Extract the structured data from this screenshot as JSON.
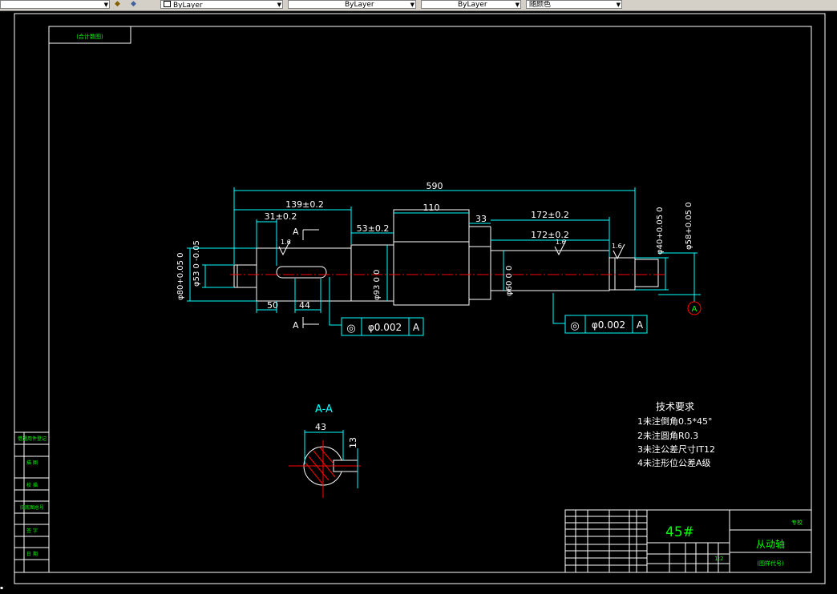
{
  "toolbar": {
    "layer1": "ByLayer",
    "layer2": "ByLayer",
    "layer3": "ByLayer",
    "color": "随颜色"
  },
  "drawing": {
    "top_left_label": "(合计数图)",
    "dims": {
      "total_length": "590",
      "len_139": "139±0.2",
      "len_31": "31±0.2",
      "len_53": "53±0.2",
      "len_110": "110",
      "len_33": "33",
      "len_172a": "172±0.2",
      "len_172b": "172±0.2",
      "len_50": "50",
      "len_44": "44",
      "dia_80": "φ80+0.05 0",
      "dia_53_left": "φ53 0 -0.05",
      "dia_93": "φ93 0 0",
      "dia_60": "φ60 0 0",
      "dia_40": "φ40+0.05 0",
      "dia_58": "φ58+0.05 0"
    },
    "roughness_left": "1.6",
    "roughness_mid": "1.6",
    "roughness_right": "1.6",
    "section_marker": "A",
    "datum_label": "A",
    "tol_left": {
      "symbol": "◎",
      "value": "φ0.002",
      "datum": "A"
    },
    "tol_right": {
      "symbol": "◎",
      "value": "φ0.002",
      "datum": "A"
    },
    "section_title": "A-A",
    "section_width": "43",
    "section_depth": "13",
    "notes_title": "技术要求",
    "notes": [
      "1未注倒角0.5*45°",
      "2未注圆角R0.3",
      "3未注公差尺寸IT12",
      "4未注形位公差A级"
    ],
    "left_strip": [
      "借通用件登记",
      "描 图",
      "校 描",
      "旧底图总号",
      "签 字",
      "日 期"
    ],
    "title_block": {
      "material": "45#",
      "part_name": "从动轴",
      "company": "专校",
      "drawing_no": "(图样代号)",
      "scale": "1:2"
    }
  }
}
